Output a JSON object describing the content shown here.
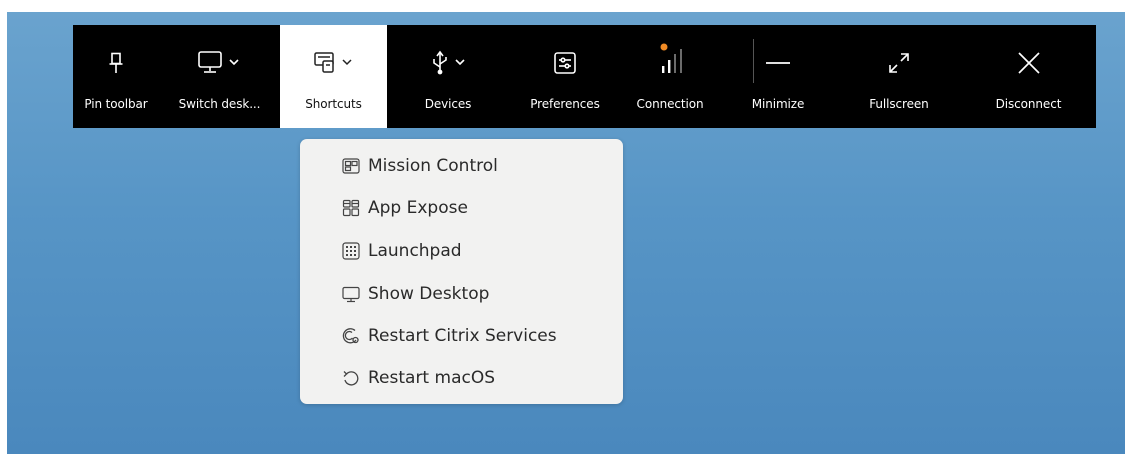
{
  "toolbar": {
    "items": [
      {
        "label": "Pin toolbar",
        "icon": "pin-icon"
      },
      {
        "label": "Switch desk...",
        "icon": "monitor-icon"
      },
      {
        "label": "Shortcuts",
        "icon": "shortcuts-icon"
      },
      {
        "label": "Devices",
        "icon": "usb-icon"
      },
      {
        "label": "Preferences",
        "icon": "preferences-icon"
      },
      {
        "label": "Connection",
        "icon": "signal-icon"
      },
      {
        "label": "Minimize",
        "icon": "minimize-icon"
      },
      {
        "label": "Fullscreen",
        "icon": "fullscreen-icon"
      },
      {
        "label": "Disconnect",
        "icon": "close-icon"
      }
    ],
    "active_item": "Shortcuts",
    "connection_status_color": "#f08a24"
  },
  "shortcuts_menu": {
    "items": [
      {
        "label": "Mission Control",
        "icon": "mission-control-icon"
      },
      {
        "label": "App Expose",
        "icon": "app-expose-icon"
      },
      {
        "label": "Launchpad",
        "icon": "launchpad-icon"
      },
      {
        "label": "Show Desktop",
        "icon": "show-desktop-icon"
      },
      {
        "label": "Restart Citrix Services",
        "icon": "restart-services-icon"
      },
      {
        "label": "Restart macOS",
        "icon": "restart-icon"
      }
    ]
  },
  "colors": {
    "toolbar_bg": "#000000",
    "desktop_bg": "#5795c6",
    "menu_bg": "#f2f2f1"
  }
}
